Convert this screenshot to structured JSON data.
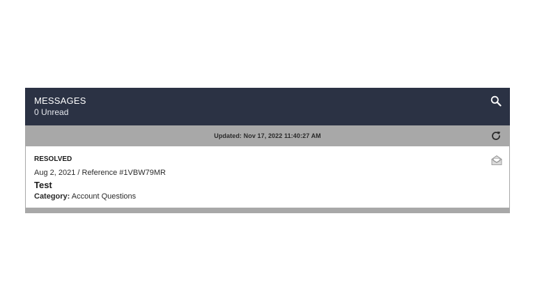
{
  "header": {
    "title": "MESSAGES",
    "unread": "0 Unread"
  },
  "status_bar": {
    "updated": "Updated: Nov 17, 2022 11:40:27 AM"
  },
  "messages": [
    {
      "status": "RESOLVED",
      "meta": "Aug 2, 2021 / Reference #1VBW79MR",
      "subject": "Test",
      "category_label": "Category:",
      "category_value": "Account Questions",
      "icon": "envelope-open-icon"
    }
  ],
  "icons": {
    "search": "search-icon",
    "refresh": "refresh-icon"
  },
  "colors": {
    "header_bg": "#2b3244",
    "bar_bg": "#a8a8a8",
    "text": "#1c1c1c"
  }
}
